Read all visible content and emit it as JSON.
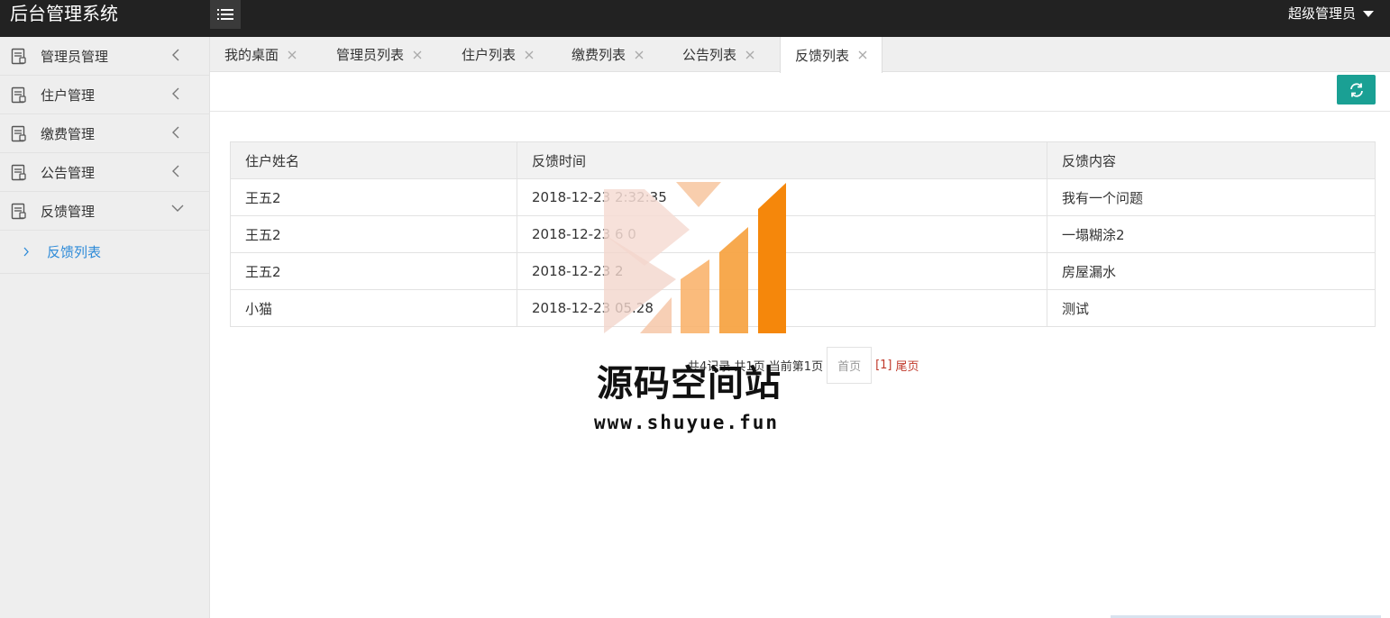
{
  "app": {
    "title": "后台管理系统"
  },
  "header": {
    "user": "超级管理员"
  },
  "sidebar": {
    "items": [
      {
        "label": "管理员管理",
        "expanded": false
      },
      {
        "label": "住户管理",
        "expanded": false
      },
      {
        "label": "缴费管理",
        "expanded": false
      },
      {
        "label": "公告管理",
        "expanded": false
      },
      {
        "label": "反馈管理",
        "expanded": true
      }
    ],
    "subitems": [
      {
        "label": "反馈列表"
      }
    ]
  },
  "tabs": [
    {
      "label": "我的桌面"
    },
    {
      "label": "管理员列表"
    },
    {
      "label": "住户列表"
    },
    {
      "label": "缴费列表"
    },
    {
      "label": "公告列表"
    },
    {
      "label": "反馈列表",
      "active": true
    }
  ],
  "table": {
    "headers": [
      "住户姓名",
      "反馈时间",
      "反馈内容"
    ],
    "rows": [
      [
        "王五2",
        "2018-12-23 2:32:35",
        "我有一个问题"
      ],
      [
        "王五2",
        "2018-12-23 6 0",
        "一塌糊涂2"
      ],
      [
        "王五2",
        "2018-12-23 2",
        "房屋漏水"
      ],
      [
        "小猫",
        "2018-12-23 05.28",
        "测试"
      ]
    ]
  },
  "pagination": {
    "summary": "共4记录 共1页 当前第1页",
    "first": "首页",
    "current": "[1]",
    "last": "尾页"
  },
  "watermark": {
    "title": "源码空间站",
    "url": "www.shuyue.fun"
  },
  "colors": {
    "topbar": "#222222",
    "accent": "#1aa094",
    "link": "#2e8bd8",
    "pager_link": "#c0392b"
  },
  "icons": {
    "menu": "list-icon",
    "nav": "document-icon",
    "refresh": "refresh-icon",
    "close": "close-icon"
  }
}
